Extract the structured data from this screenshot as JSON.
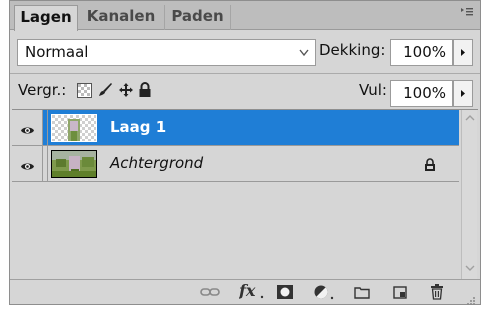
{
  "tabs": [
    {
      "label": "Lagen",
      "active": true
    },
    {
      "label": "Kanalen",
      "active": false
    },
    {
      "label": "Paden",
      "active": false
    }
  ],
  "blend_mode": {
    "selected": "Normaal"
  },
  "opacity": {
    "label": "Dekking:",
    "value": "100%"
  },
  "lock": {
    "label": "Vergr.:"
  },
  "fill": {
    "label": "Vul:",
    "value": "100%"
  },
  "layers": [
    {
      "name": "Laag 1",
      "selected": true,
      "visible": true,
      "locked": false
    },
    {
      "name": "Achtergrond",
      "selected": false,
      "visible": true,
      "locked": true
    }
  ],
  "colors": {
    "selection": "#1f7ed6",
    "panel": "#d6d6d6"
  },
  "icons": {
    "toolbar": [
      "link-layers-icon",
      "fx-icon",
      "add-mask-icon",
      "adjustment-layer-icon",
      "new-group-icon",
      "new-layer-icon",
      "trash-icon"
    ]
  }
}
